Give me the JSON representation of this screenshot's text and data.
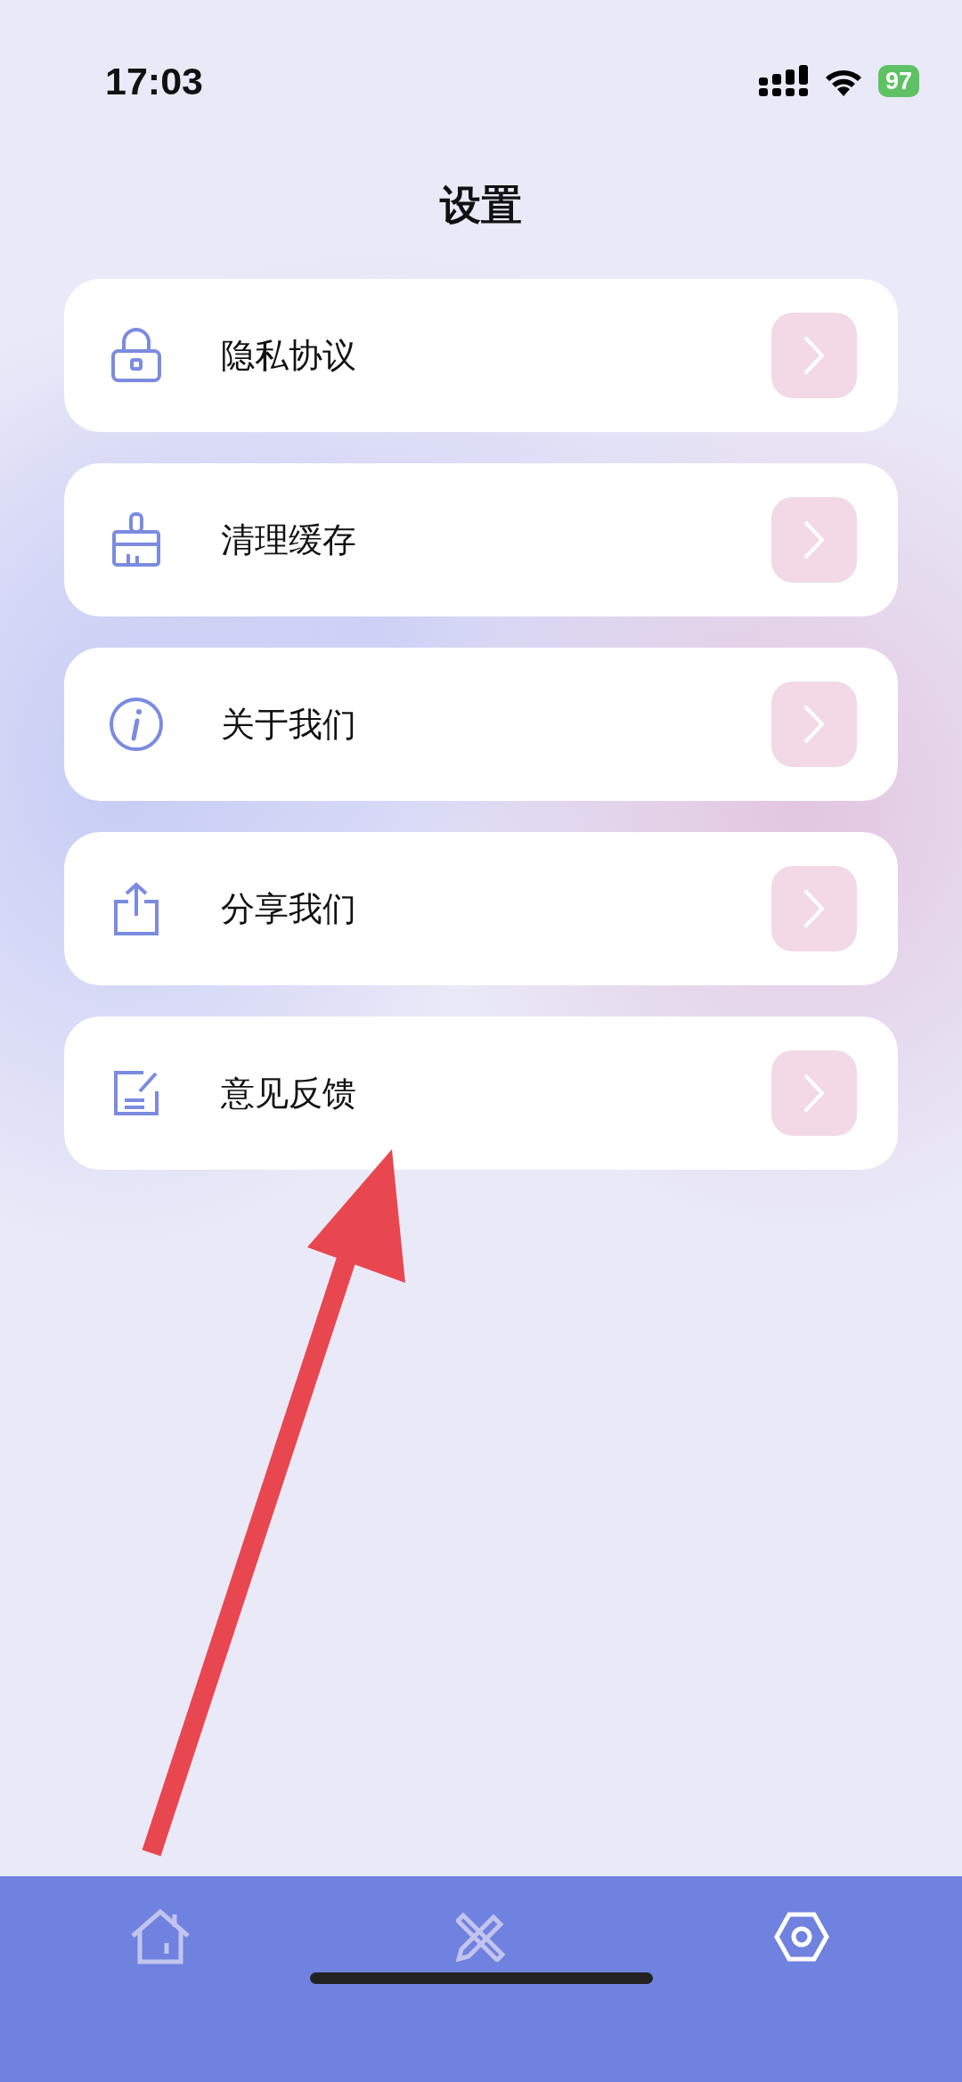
{
  "status_bar": {
    "time": "17:03",
    "battery": "97"
  },
  "title": "设置",
  "items": [
    {
      "kind": "lock",
      "label": "隐私协议"
    },
    {
      "kind": "broom",
      "label": "清理缓存"
    },
    {
      "kind": "info",
      "label": "关于我们"
    },
    {
      "kind": "share",
      "label": "分享我们"
    },
    {
      "kind": "edit",
      "label": "意见反馈"
    }
  ],
  "tabs": [
    {
      "kind": "home",
      "selected": false
    },
    {
      "kind": "tools",
      "selected": false
    },
    {
      "kind": "settings",
      "selected": true
    }
  ]
}
